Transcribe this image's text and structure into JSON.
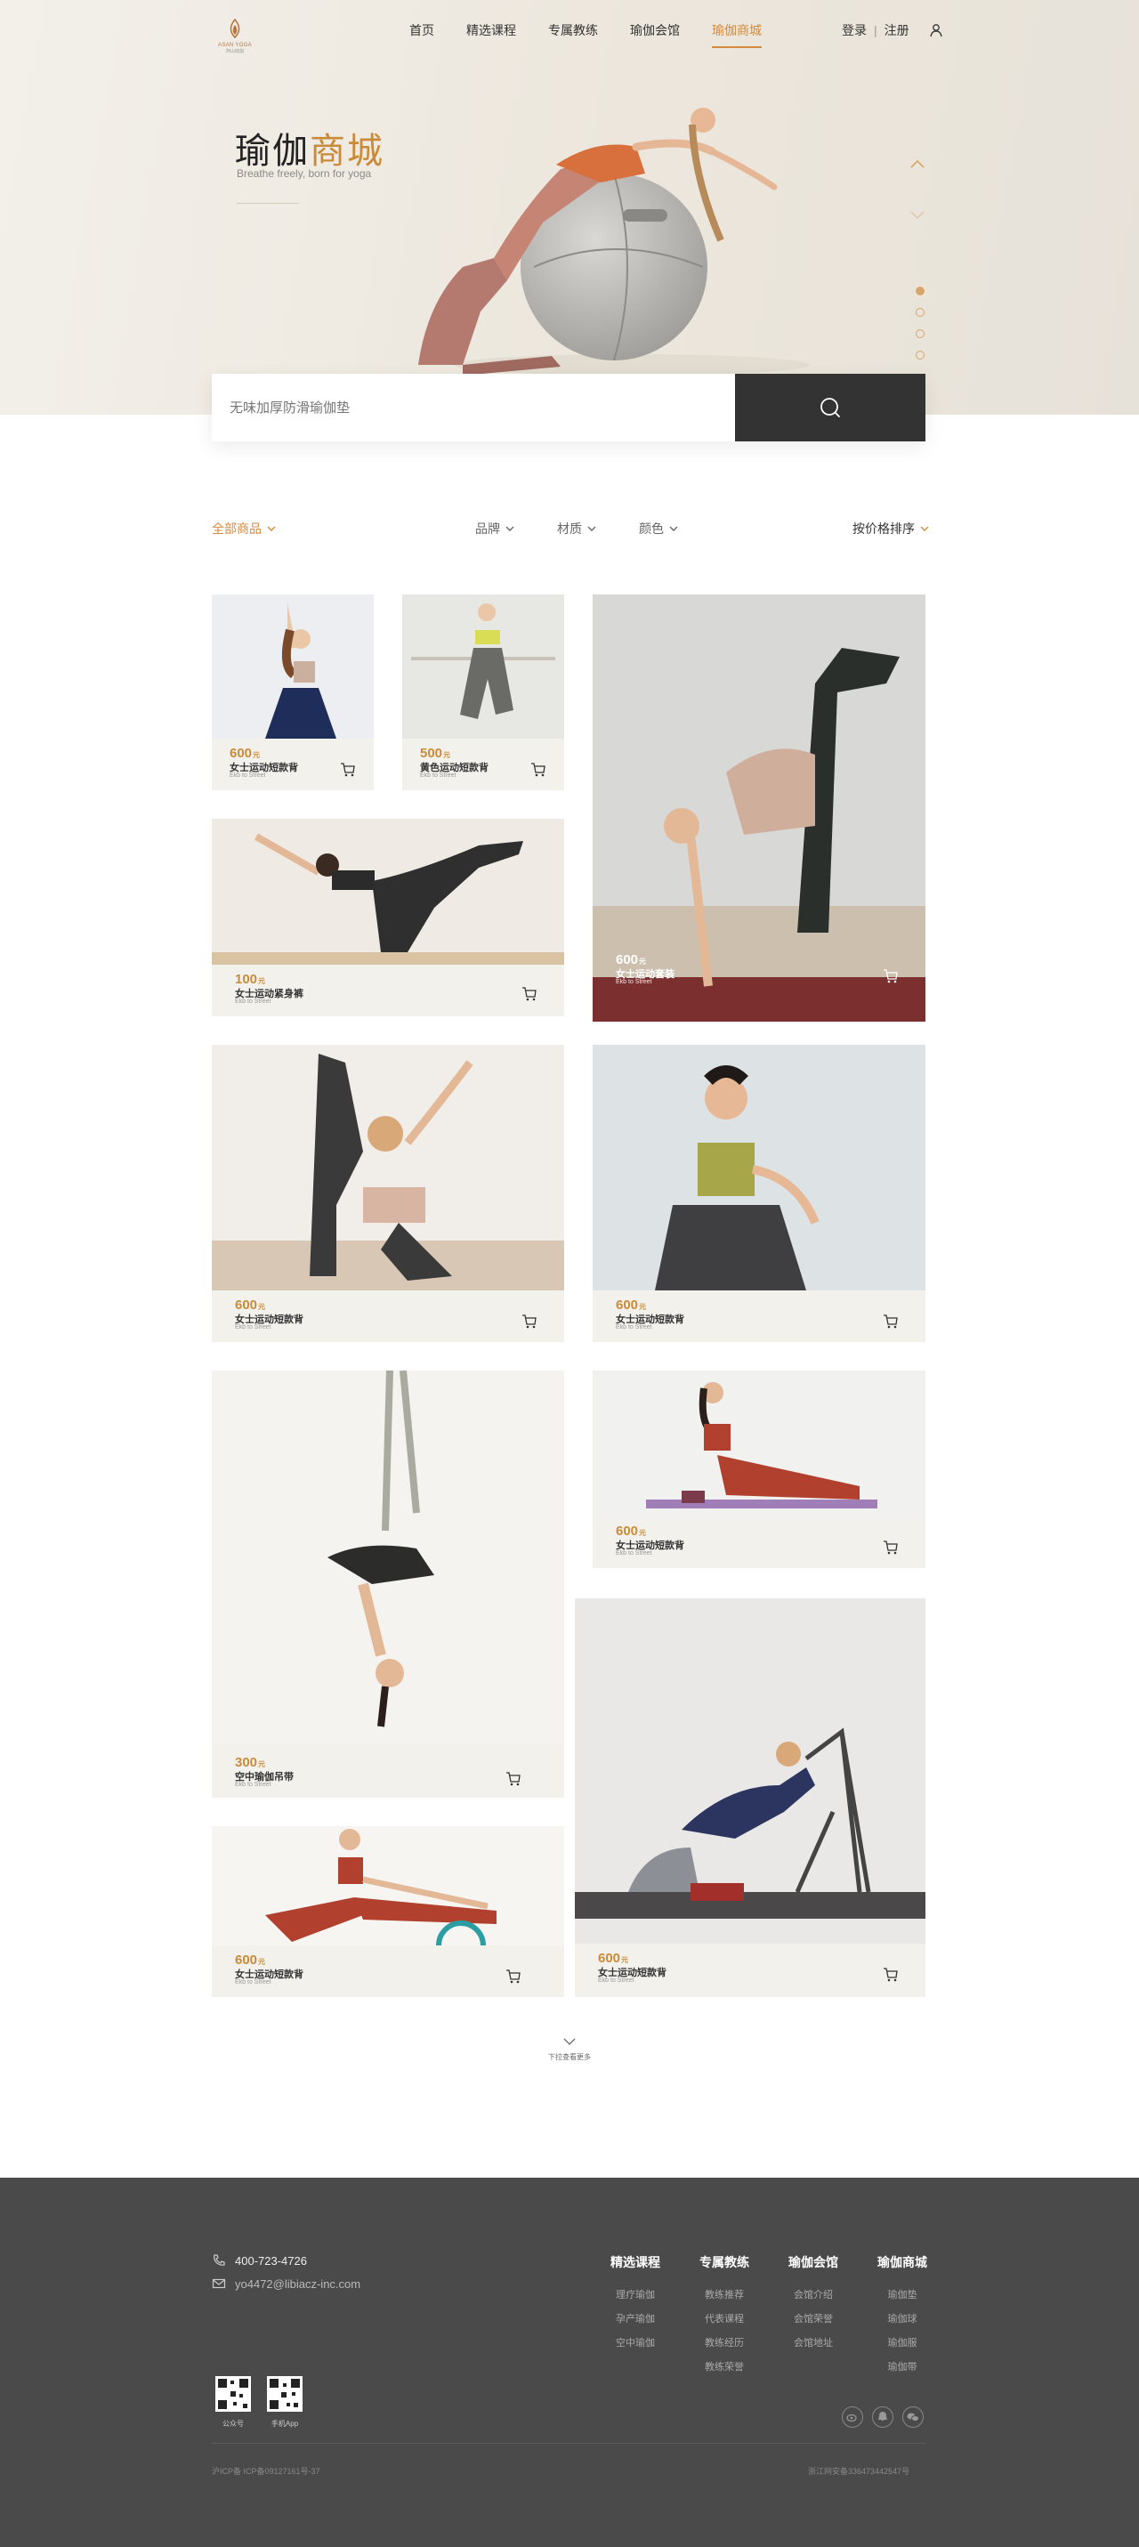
{
  "header": {
    "logo_en": "ASAN YOGA",
    "logo_cn": "阿山瑜伽",
    "nav": [
      "首页",
      "精选课程",
      "专属教练",
      "瑜伽会馆",
      "瑜伽商城"
    ],
    "login": "登录",
    "divider": "|",
    "register": "注册"
  },
  "hero": {
    "title_prefix": "瑜伽",
    "title_accent": "商城",
    "subtitle": "Breathe freely, born for yoga"
  },
  "search": {
    "placeholder": "无味加厚防滑瑜伽垫"
  },
  "filters": {
    "all": "全部商品",
    "brand": "品牌",
    "material": "材质",
    "color": "颜色",
    "sort": "按价格排序"
  },
  "products": [
    {
      "price": "600",
      "unit": "元",
      "name": "女士运动短款背",
      "sub": "Ekb to Street"
    },
    {
      "price": "500",
      "unit": "元",
      "name": "黄色运动短款背",
      "sub": "Ekb to Street"
    },
    {
      "price": "600",
      "unit": "元",
      "name": "女士运动套装",
      "sub": "Ekb to Street"
    },
    {
      "price": "100",
      "unit": "元",
      "name": "女士运动紧身裤",
      "sub": "Ekb to Street"
    },
    {
      "price": "600",
      "unit": "元",
      "name": "女士运动短款背",
      "sub": "Ekb to Street"
    },
    {
      "price": "600",
      "unit": "元",
      "name": "女士运动短款背",
      "sub": "Ekb to Street"
    },
    {
      "price": "300",
      "unit": "元",
      "name": "空中瑜伽吊带",
      "sub": "Ekb to Street"
    },
    {
      "price": "600",
      "unit": "元",
      "name": "女士运动短款背",
      "sub": "Ekb to Street"
    },
    {
      "price": "600",
      "unit": "元",
      "name": "女士运动短款背",
      "sub": "Ekb to Street"
    },
    {
      "price": "600",
      "unit": "元",
      "name": "女士运动短款背",
      "sub": "Ekb to Street"
    }
  ],
  "load_more": "下拉查看更多",
  "footer": {
    "phone": "400-723-4726",
    "email": "yo4472@libiacz-inc.com",
    "columns": [
      {
        "title": "精选课程",
        "items": [
          "理疗瑜伽",
          "孕产瑜伽",
          "空中瑜伽"
        ]
      },
      {
        "title": "专属教练",
        "items": [
          "教练推荐",
          "代表课程",
          "教练经历",
          "教练荣誉"
        ]
      },
      {
        "title": "瑜伽会馆",
        "items": [
          "会馆介绍",
          "会馆荣誉",
          "会馆地址"
        ]
      },
      {
        "title": "瑜伽商城",
        "items": [
          "瑜伽垫",
          "瑜伽球",
          "瑜伽服",
          "瑜伽带"
        ]
      }
    ],
    "qr": [
      "公众号",
      "手机App"
    ],
    "copyright_left": "沪ICP备 ICP备09127161号-37",
    "copyright_right": "浙江网安备336473442547号"
  }
}
